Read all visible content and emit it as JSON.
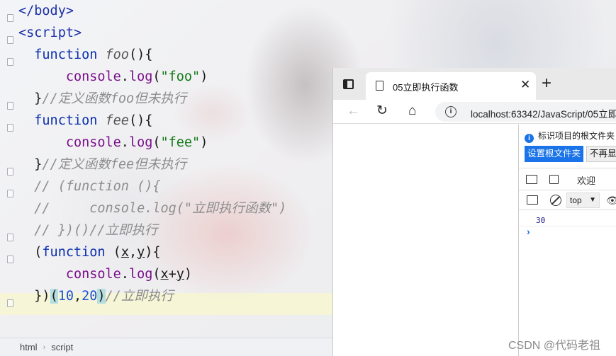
{
  "editor": {
    "lines": [
      {
        "t": [
          [
            "tag",
            "</body>"
          ]
        ]
      },
      {
        "t": [
          [
            "tag",
            "<script>"
          ]
        ]
      },
      {
        "t": [
          [
            "",
            "  "
          ],
          [
            "kw",
            "function "
          ],
          [
            "fn-i",
            "foo"
          ],
          [
            "",
            "(){"
          ]
        ]
      },
      {
        "t": [
          [
            "",
            "      "
          ],
          [
            "fld",
            "console"
          ],
          [
            "",
            "."
          ],
          [
            "fld",
            "log"
          ],
          [
            "",
            "("
          ],
          [
            "str",
            "\"foo\""
          ],
          [
            "",
            ")"
          ]
        ]
      },
      {
        "t": [
          [
            "",
            "  }"
          ],
          [
            "cmt",
            "//定义函数foo但未执行"
          ]
        ]
      },
      {
        "t": [
          [
            "",
            "  "
          ],
          [
            "kw",
            "function "
          ],
          [
            "fn-i",
            "fee"
          ],
          [
            "",
            "(){"
          ]
        ]
      },
      {
        "t": [
          [
            "",
            "      "
          ],
          [
            "fld",
            "console"
          ],
          [
            "",
            "."
          ],
          [
            "fld",
            "log"
          ],
          [
            "",
            "("
          ],
          [
            "str",
            "\"fee\""
          ],
          [
            "",
            ")"
          ]
        ]
      },
      {
        "t": [
          [
            "",
            "  }"
          ],
          [
            "cmt",
            "//定义函数fee但未执行"
          ]
        ]
      },
      {
        "t": [
          [
            "cmt",
            "  // (function (){"
          ]
        ]
      },
      {
        "t": [
          [
            "cmt",
            "  //     console.log(\"立即执行函数\")"
          ]
        ]
      },
      {
        "t": [
          [
            "cmt",
            "  // })()//立即执行"
          ]
        ]
      },
      {
        "t": [
          [
            "",
            "  ("
          ],
          [
            "kw",
            "function "
          ],
          [
            "",
            "("
          ],
          [
            "par",
            "x"
          ],
          [
            "",
            ","
          ],
          [
            "par",
            "y"
          ],
          [
            "",
            "){"
          ]
        ]
      },
      {
        "t": [
          [
            "",
            "      "
          ],
          [
            "fld",
            "console"
          ],
          [
            "",
            "."
          ],
          [
            "fld",
            "log"
          ],
          [
            "",
            "("
          ],
          [
            "par",
            "x"
          ],
          [
            "",
            "+"
          ],
          [
            "par",
            "y"
          ],
          [
            "",
            ")"
          ]
        ]
      },
      {
        "t": [
          [
            "",
            "  })"
          ],
          [
            "brk",
            "("
          ],
          [
            "num",
            "10"
          ],
          [
            "",
            ","
          ],
          [
            "num",
            "20"
          ],
          [
            "brk",
            ")"
          ],
          [
            "cmt",
            "//立即执行"
          ]
        ]
      }
    ],
    "breadcrumb": [
      "html",
      "script"
    ]
  },
  "browser": {
    "tab_title": "05立即执行函数",
    "url": "localhost:63342/JavaScript/05立即",
    "devtools": {
      "info_text": "标识项目的根文件夹",
      "set_root_button": "设置根文件夹",
      "dont_show_button": "不再显示",
      "welcome_tab": "欢迎",
      "context": "top",
      "console_output": "30",
      "prompt": "›"
    }
  },
  "watermark": "CSDN @代码老祖"
}
